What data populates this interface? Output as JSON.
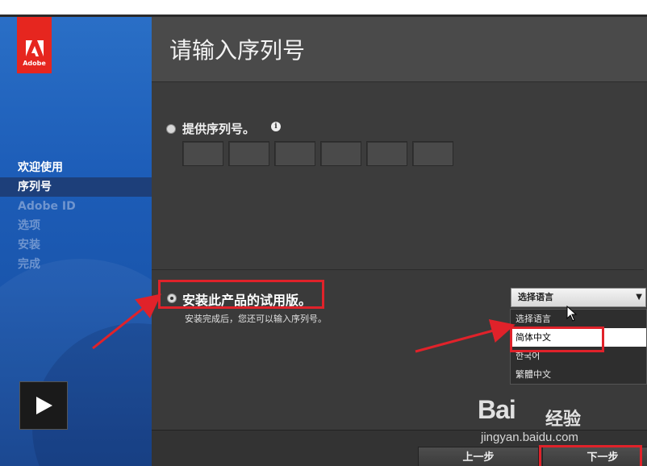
{
  "window": {
    "title": "请输入序列号"
  },
  "brand": {
    "logo_text": "Adobe",
    "color": "#e6261f"
  },
  "sidebar": {
    "steps": [
      {
        "label": "欢迎使用",
        "state": "done"
      },
      {
        "label": "序列号",
        "state": "active"
      },
      {
        "label": "Adobe ID",
        "state": "pending"
      },
      {
        "label": "选项",
        "state": "pending"
      },
      {
        "label": "安装",
        "state": "pending"
      },
      {
        "label": "完成",
        "state": "pending"
      }
    ],
    "video_icon": "play-icon"
  },
  "serial": {
    "label": "提供序列号。",
    "info_icon": "info-icon",
    "selected": false,
    "box_count": 6
  },
  "trial": {
    "label": "安装此产品的试用版。",
    "description": "安装完成后，您还可以输入序列号。",
    "selected": true
  },
  "language": {
    "current": "选择语言",
    "options": [
      "选择语言",
      "简体中文",
      "한국어",
      "繁體中文"
    ],
    "highlighted_index": 1
  },
  "footer": {
    "prev_label": "上一步",
    "next_label": "下一步"
  },
  "watermark": {
    "logo": "Bai",
    "logo_suffix": "经验",
    "url": "jingyan.baidu.com"
  },
  "annotation_color": "#e0222a"
}
